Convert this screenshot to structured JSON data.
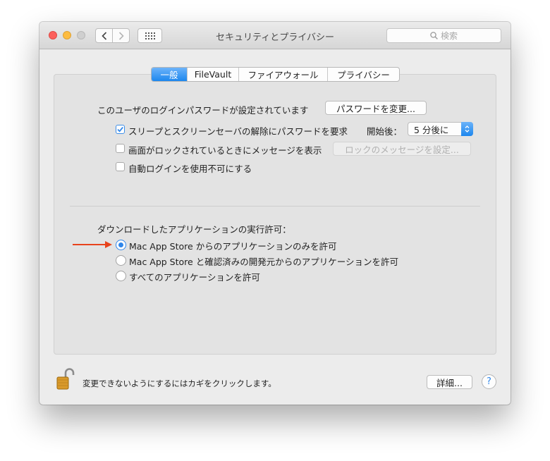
{
  "window": {
    "title": "セキュリティとプライバシー",
    "search_placeholder": "検索",
    "toolbar_icons": [
      "back-chevron-icon",
      "forward-chevron-icon",
      "show-all-grid-icon",
      "search-icon"
    ]
  },
  "tabs": [
    {
      "label": "一般",
      "active": true
    },
    {
      "label": "FileVault",
      "active": false
    },
    {
      "label": "ファイアウォール",
      "active": false
    },
    {
      "label": "プライバシー",
      "active": false
    }
  ],
  "general": {
    "login_password_text": "このユーザのログインパスワードが設定されています",
    "change_password_button": "パスワードを変更...",
    "options": [
      {
        "label": "スリープとスクリーンセーバの解除にパスワードを要求",
        "checked": true
      },
      {
        "label": "画面がロックされているときにメッセージを表示",
        "checked": false
      },
      {
        "label": "自動ログインを使用不可にする",
        "checked": false
      }
    ],
    "delay_label": "開始後：",
    "delay_value": "5 分後に",
    "lock_message_button": "ロックのメッセージを設定..."
  },
  "downloads": {
    "heading": "ダウンロードしたアプリケーションの実行許可：",
    "options": [
      {
        "label": "Mac App Store からのアプリケーションのみを許可",
        "selected": true
      },
      {
        "label": "Mac App Store と確認済みの開発元からのアプリケーションを許可",
        "selected": false
      },
      {
        "label": "すべてのアプリケーションを許可",
        "selected": false
      }
    ]
  },
  "footer": {
    "lock_text": "変更できないようにするにはカギをクリックします。",
    "advanced_button": "詳細...",
    "help_label": "?"
  },
  "colors": {
    "accent": "#2f86ea",
    "annotation_arrow": "#e8431c",
    "lock": "#d99a2b"
  }
}
